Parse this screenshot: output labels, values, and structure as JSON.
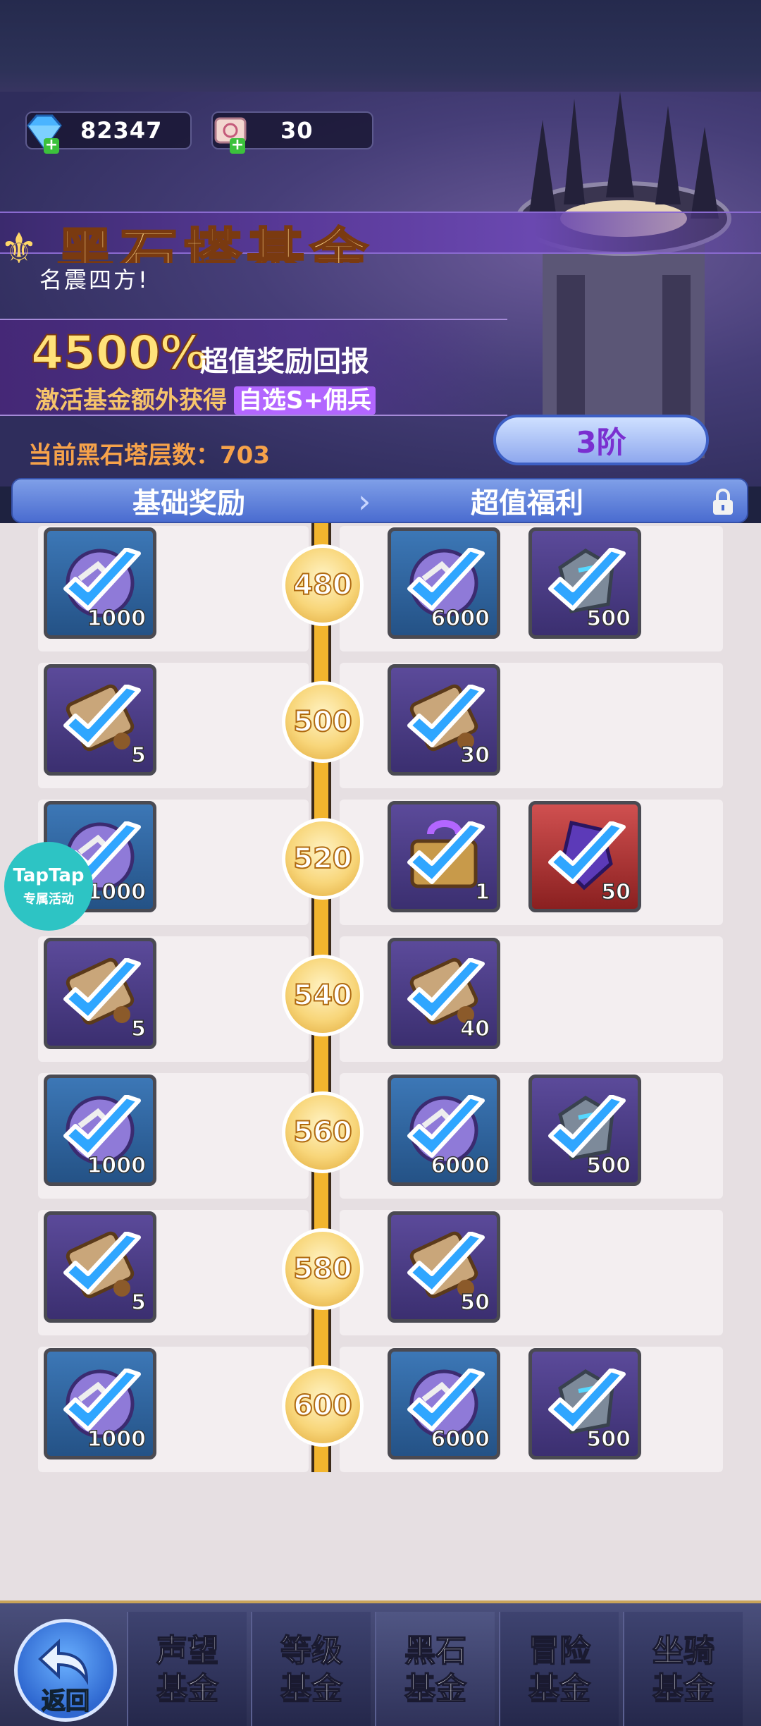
{
  "currencies": [
    {
      "name": "diamond",
      "value": "82347",
      "icon": "diamond-icon"
    },
    {
      "name": "ticket",
      "value": "30",
      "icon": "scroll-ticket-icon"
    }
  ],
  "banner": {
    "title": "黑石塔基金",
    "subtitle": "名震四方!",
    "promo_percent": "4500%",
    "promo_text": "超值奖励回报",
    "promo_line2_a": "激活基金额外获得",
    "promo_line2_b": "自选S+佣兵",
    "floor_label": "当前黑石塔层数：",
    "floor_value": "703",
    "tier": "3阶"
  },
  "tabs": {
    "basic": "基础奖励",
    "premium": "超值福利"
  },
  "rows": [
    {
      "level": "480",
      "basic": [
        {
          "type": "orb",
          "qty": "1000",
          "bg": "blue"
        }
      ],
      "premium": [
        {
          "type": "orb",
          "qty": "6000",
          "bg": "blue"
        },
        {
          "type": "stone",
          "qty": "500",
          "bg": "purple"
        }
      ]
    },
    {
      "level": "500",
      "basic": [
        {
          "type": "scroll",
          "qty": "5",
          "bg": "purple"
        }
      ],
      "premium": [
        {
          "type": "scroll",
          "qty": "30",
          "bg": "purple"
        }
      ]
    },
    {
      "level": "520",
      "basic": [
        {
          "type": "orb",
          "qty": "1000",
          "bg": "blue"
        }
      ],
      "premium": [
        {
          "type": "chest",
          "qty": "1",
          "bg": "purple"
        },
        {
          "type": "crystal",
          "qty": "50",
          "bg": "red"
        }
      ]
    },
    {
      "level": "540",
      "basic": [
        {
          "type": "scroll",
          "qty": "5",
          "bg": "purple"
        }
      ],
      "premium": [
        {
          "type": "scroll",
          "qty": "40",
          "bg": "purple"
        }
      ]
    },
    {
      "level": "560",
      "basic": [
        {
          "type": "orb",
          "qty": "1000",
          "bg": "blue"
        }
      ],
      "premium": [
        {
          "type": "orb",
          "qty": "6000",
          "bg": "blue"
        },
        {
          "type": "stone",
          "qty": "500",
          "bg": "purple"
        }
      ]
    },
    {
      "level": "580",
      "basic": [
        {
          "type": "scroll",
          "qty": "5",
          "bg": "purple"
        }
      ],
      "premium": [
        {
          "type": "scroll",
          "qty": "50",
          "bg": "purple"
        }
      ]
    },
    {
      "level": "600",
      "basic": [
        {
          "type": "orb",
          "qty": "1000",
          "bg": "blue"
        }
      ],
      "premium": [
        {
          "type": "orb",
          "qty": "6000",
          "bg": "blue"
        },
        {
          "type": "stone",
          "qty": "500",
          "bg": "purple"
        }
      ]
    }
  ],
  "taptap": {
    "line1": "TapTap",
    "line2": "专属活动"
  },
  "nav": {
    "back": "返回",
    "items": [
      {
        "line1": "声望",
        "line2": "基金",
        "active": false
      },
      {
        "line1": "等级",
        "line2": "基金",
        "active": false
      },
      {
        "line1": "黑石",
        "line2": "基金",
        "active": true
      },
      {
        "line1": "冒险",
        "line2": "基金",
        "active": false
      },
      {
        "line1": "坐骑",
        "line2": "基金",
        "active": false
      }
    ]
  },
  "colors": {
    "accent_gold": "#f2b52e",
    "tab_blue": "#4a6cd0",
    "check_blue": "#2fa6ff",
    "tier_text": "#7a2fd0"
  }
}
